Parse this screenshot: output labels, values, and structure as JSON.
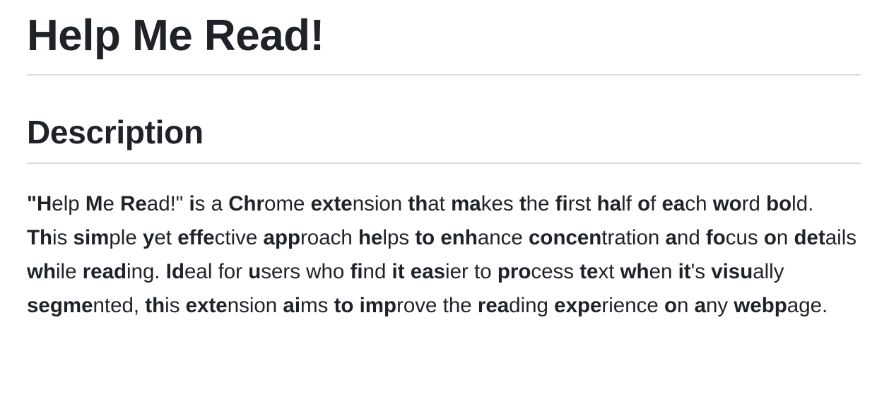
{
  "document": {
    "title": "Help Me Read!",
    "section_heading": "Description",
    "paragraph": [
      {
        "b": "\"H",
        "r": "elp "
      },
      {
        "b": "M",
        "r": "e "
      },
      {
        "b": "Re",
        "r": "ad!\" "
      },
      {
        "b": "i",
        "r": "s "
      },
      {
        "b": "",
        "r": "a "
      },
      {
        "b": "Chr",
        "r": "ome "
      },
      {
        "b": "exte",
        "r": "nsion "
      },
      {
        "b": "th",
        "r": "at "
      },
      {
        "b": "ma",
        "r": "kes "
      },
      {
        "b": "t",
        "r": "he "
      },
      {
        "b": "fi",
        "r": "rst "
      },
      {
        "b": "ha",
        "r": "lf "
      },
      {
        "b": "o",
        "r": "f "
      },
      {
        "b": "ea",
        "r": "ch "
      },
      {
        "b": "wo",
        "r": "rd "
      },
      {
        "b": "bo",
        "r": "ld. "
      },
      {
        "b": "Th",
        "r": "is "
      },
      {
        "b": "sim",
        "r": "ple "
      },
      {
        "b": "y",
        "r": "et "
      },
      {
        "b": "effe",
        "r": "ctive "
      },
      {
        "b": "app",
        "r": "roach "
      },
      {
        "b": "he",
        "r": "lps "
      },
      {
        "b": "to",
        "r": " "
      },
      {
        "b": "enh",
        "r": "ance "
      },
      {
        "b": "concen",
        "r": "tration "
      },
      {
        "b": "a",
        "r": "nd "
      },
      {
        "b": "fo",
        "r": "cus "
      },
      {
        "b": "o",
        "r": "n "
      },
      {
        "b": "det",
        "r": "ails "
      },
      {
        "b": "wh",
        "r": "ile "
      },
      {
        "b": "read",
        "r": "ing. "
      },
      {
        "b": "Id",
        "r": "eal "
      },
      {
        "b": "",
        "r": "for "
      },
      {
        "b": "u",
        "r": "sers "
      },
      {
        "b": "",
        "r": "who "
      },
      {
        "b": "fi",
        "r": "nd "
      },
      {
        "b": "it",
        "r": " "
      },
      {
        "b": "eas",
        "r": "ier "
      },
      {
        "b": "",
        "r": "to "
      },
      {
        "b": "pro",
        "r": "cess "
      },
      {
        "b": "te",
        "r": "xt "
      },
      {
        "b": "wh",
        "r": "en "
      },
      {
        "b": "it",
        "r": "'s "
      },
      {
        "b": "visu",
        "r": "ally "
      },
      {
        "b": "segme",
        "r": "nted, "
      },
      {
        "b": "th",
        "r": "is "
      },
      {
        "b": "exte",
        "r": "nsion "
      },
      {
        "b": "ai",
        "r": "ms "
      },
      {
        "b": "to",
        "r": " "
      },
      {
        "b": "imp",
        "r": "rove "
      },
      {
        "b": "",
        "r": "the "
      },
      {
        "b": "rea",
        "r": "ding "
      },
      {
        "b": "expe",
        "r": "rience "
      },
      {
        "b": "o",
        "r": "n "
      },
      {
        "b": "a",
        "r": "ny "
      },
      {
        "b": "webp",
        "r": "age."
      }
    ]
  }
}
